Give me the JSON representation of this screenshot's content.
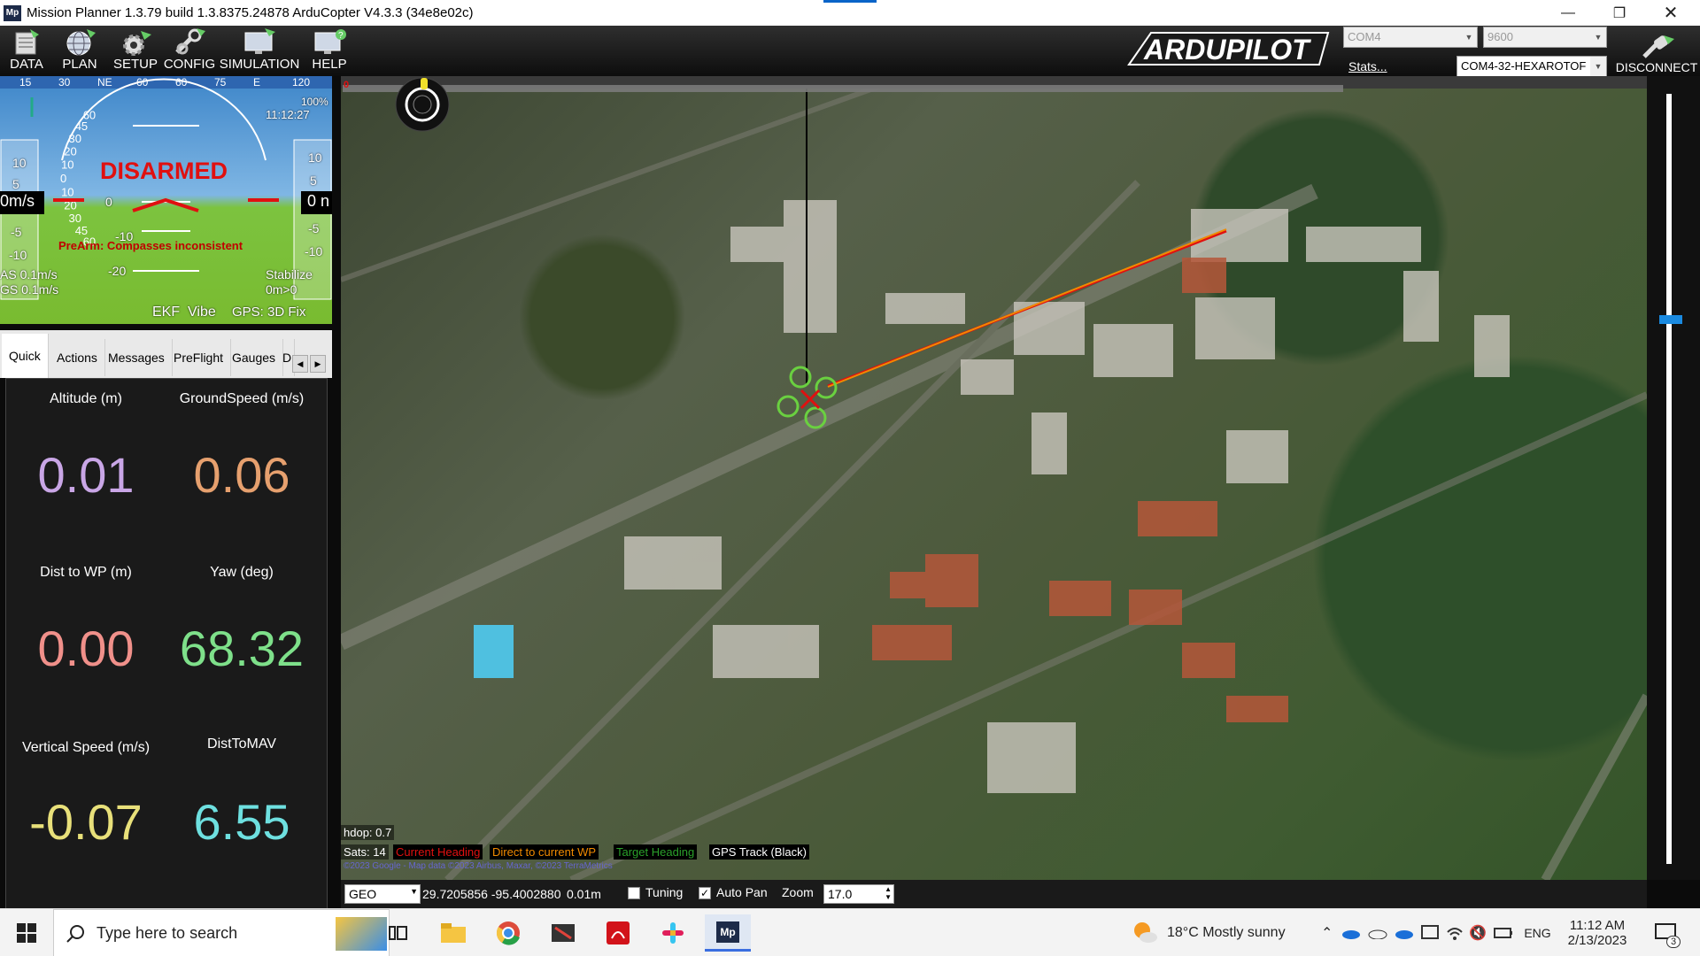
{
  "window": {
    "title": "Mission Planner 1.3.79 build 1.3.8375.24878 ArduCopter V4.3.3 (34e8e02c)",
    "app_icon": "Mp"
  },
  "toolbar": {
    "buttons": [
      {
        "label": "DATA",
        "icon": "data-icon"
      },
      {
        "label": "PLAN",
        "icon": "globe-icon"
      },
      {
        "label": "SETUP",
        "icon": "setup-gear-icon"
      },
      {
        "label": "CONFIG",
        "icon": "config-icon"
      },
      {
        "label": "SIMULATION",
        "icon": "simulation-icon"
      },
      {
        "label": "HELP",
        "icon": "help-icon"
      }
    ],
    "logo": "ARDUPILOT",
    "port": "COM4",
    "baud": "9600",
    "stats_link": "Stats...",
    "connection": "COM4-32-HEXAROTOF",
    "disconnect_label": "DISCONNECT"
  },
  "hud": {
    "status": "DISARMED",
    "prearm": "PreArm: Compasses inconsistent",
    "airspeed": "AS 0.1m/s",
    "groundspeed": "GS 0.1m/s",
    "mode": "Stabilize",
    "distance": "0m>0",
    "ekf": "EKF",
    "vibe": "Vibe",
    "gps": "GPS: 3D Fix",
    "time": "11:12:27",
    "battery": "100%",
    "speed_left": "0m/s",
    "speed_right": "0 n",
    "heading_ticks": [
      "15",
      "30",
      "NE",
      "60",
      "60",
      "75",
      "E",
      "120"
    ],
    "roll_scale": [
      "60",
      "45",
      "30",
      "20",
      "10",
      "0",
      "10",
      "20",
      "30",
      "45",
      "60"
    ],
    "pitch_labels": [
      "-10",
      "-20"
    ],
    "left_ticks": [
      "10",
      "5",
      "-5",
      "-10"
    ],
    "right_ticks": [
      "10",
      "5",
      "-5",
      "-10"
    ],
    "horizon_zero": "0"
  },
  "tabs": [
    {
      "label": "Quick",
      "active": true
    },
    {
      "label": "Actions"
    },
    {
      "label": "Messages"
    },
    {
      "label": "PreFlight"
    },
    {
      "label": "Gauges"
    },
    {
      "label": "D"
    }
  ],
  "quick": [
    {
      "label": "Altitude (m)",
      "value": "0.01",
      "color": "#c9a6e6"
    },
    {
      "label": "GroundSpeed (m/s)",
      "value": "0.06",
      "color": "#e6a06e"
    },
    {
      "label": "Dist to WP (m)",
      "value": "0.00",
      "color": "#f0908a"
    },
    {
      "label": "Yaw (deg)",
      "value": "68.32",
      "color": "#7ee08a"
    },
    {
      "label": "Vertical Speed (m/s)",
      "value": "-0.07",
      "color": "#e8e07a"
    },
    {
      "label": "DistToMAV",
      "value": "6.55",
      "color": "#6ee0e0"
    }
  ],
  "map": {
    "hdop": "hdop: 0.7",
    "sats": "Sats: 14",
    "legend": [
      {
        "label": "Current Heading",
        "color": "#e01010"
      },
      {
        "label": "Direct to current WP",
        "color": "#f08a00"
      },
      {
        "label": "Target Heading",
        "color": "#2aa02a"
      },
      {
        "label": "GPS Track (Black)",
        "color": "#ffffff"
      }
    ],
    "attribution": "©2023 Google - Map data ©2023 Airbus, Maxar, ©2023 TerraMetrics",
    "waypoint_marker": "0"
  },
  "mapstatus": {
    "coord_system": "GEO",
    "coordinates": "29.7205856 -95.4002880",
    "altitude": "0.01m",
    "tuning_label": "Tuning",
    "tuning_checked": false,
    "autopan_label": "Auto Pan",
    "autopan_checked": true,
    "zoom_label": "Zoom",
    "zoom_value": "17.0"
  },
  "taskbar": {
    "search_placeholder": "Type here to search",
    "weather": "18°C  Mostly sunny",
    "language": "ENG",
    "time": "11:12 AM",
    "date": "2/13/2023",
    "notifications": "3"
  }
}
